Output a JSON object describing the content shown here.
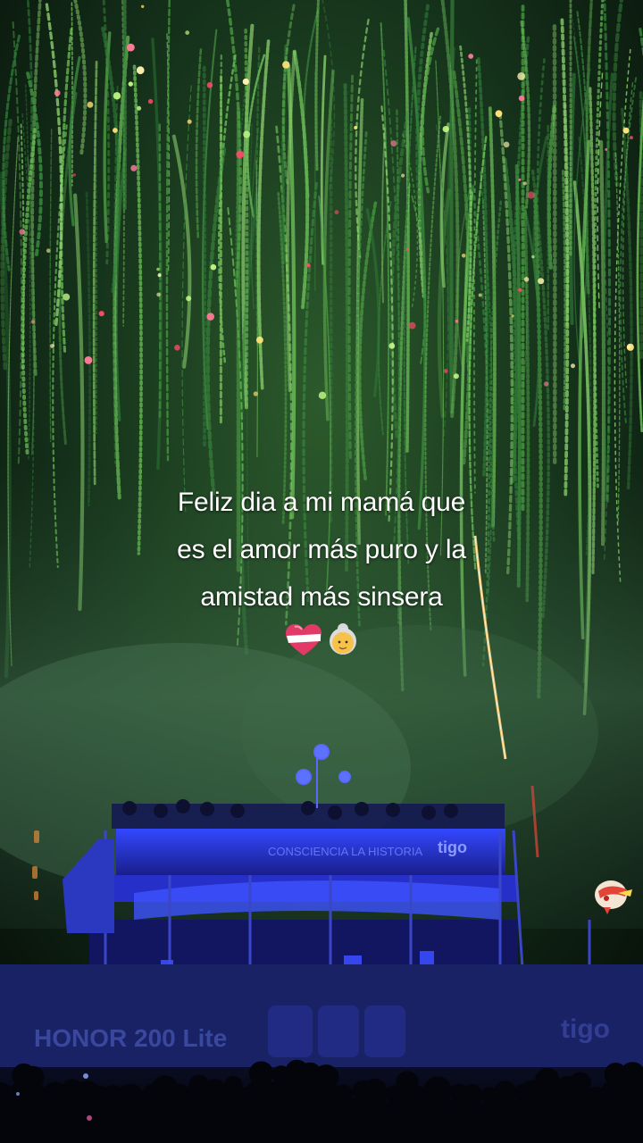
{
  "caption": {
    "line1": "Feliz dia a mi mamá que",
    "line2": "es el amor más puro y la",
    "line3": "amistad más sinsera"
  },
  "emojis": [
    "heart-with-ribbon-icon",
    "older-woman-icon"
  ],
  "stage": {
    "banner_text": "CONSCIENCIA LA HISTORIA",
    "banner_logo": "tigo",
    "lower_banner_text": "HONOR 200 Lite",
    "lower_banner_logo": "tigo"
  },
  "colors": {
    "fireworks_green": "#3f8f3a",
    "stage_blue": "#2a3cff",
    "caption_text": "#ffffff"
  }
}
